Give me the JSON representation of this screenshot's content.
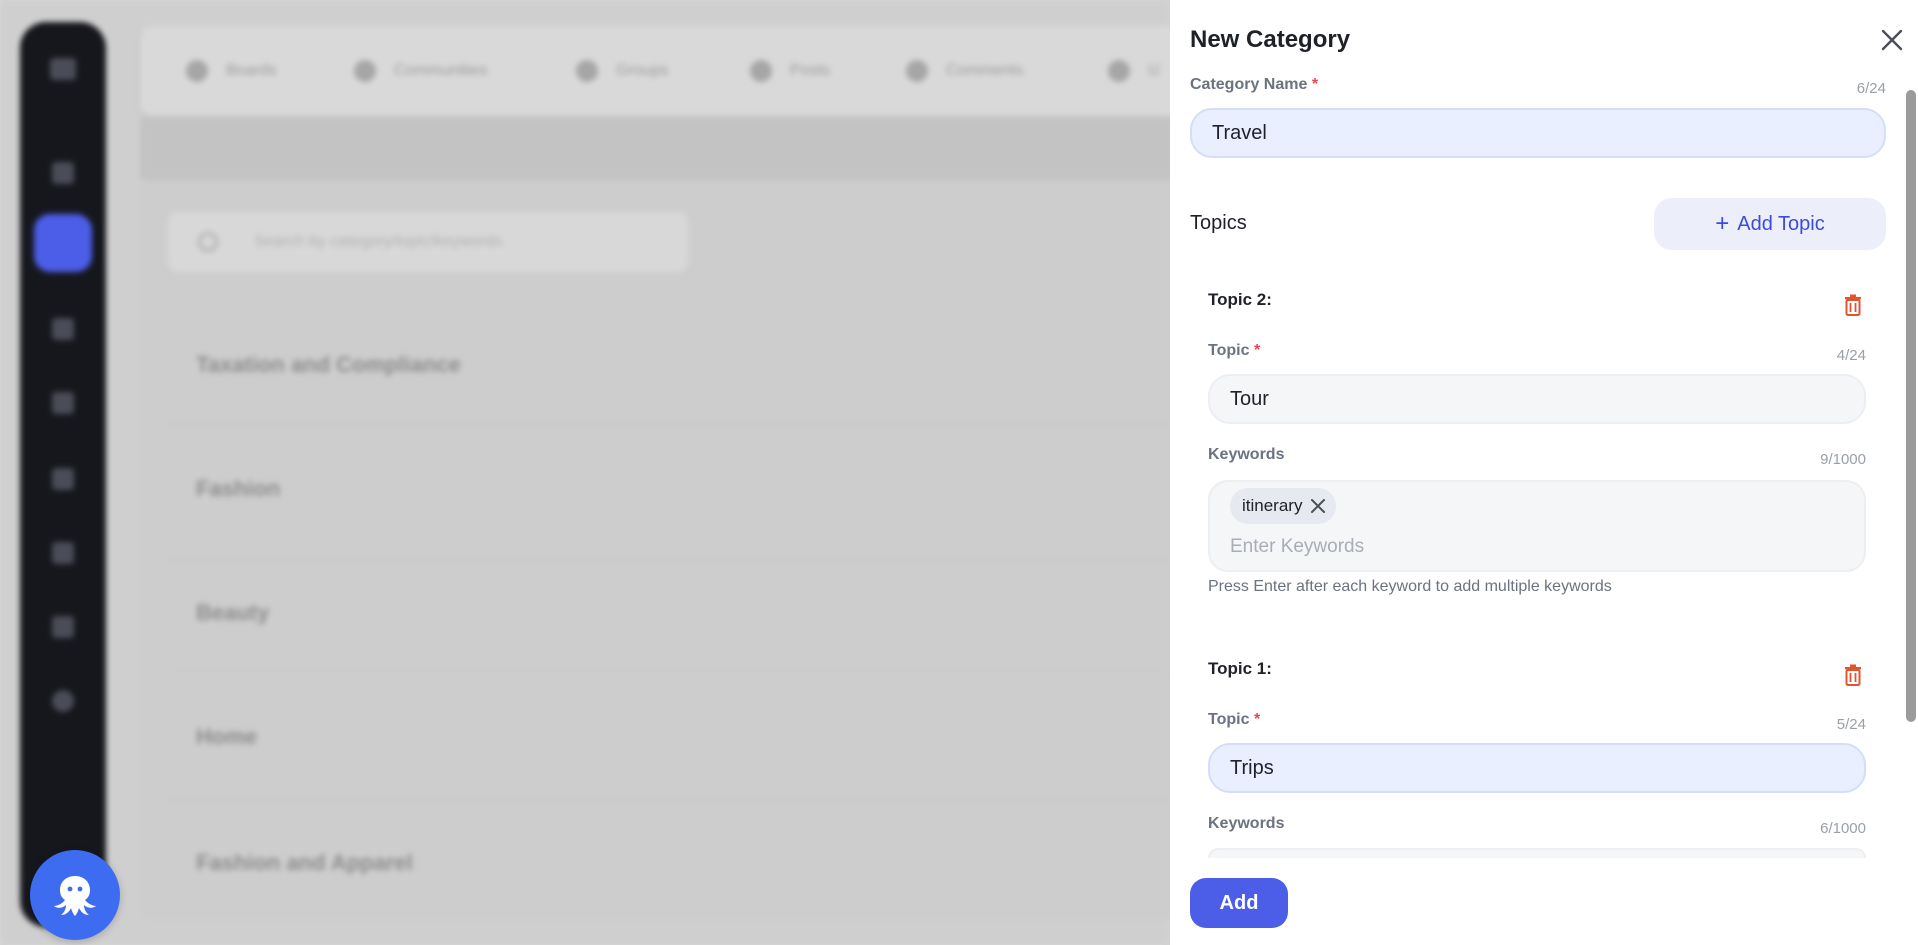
{
  "background": {
    "nav_items": [
      "Boards",
      "Communities",
      "Groups",
      "Posts",
      "Comments",
      "U"
    ],
    "search_placeholder": "Search by category/topic/keywords",
    "rows": [
      "Taxation and Compliance",
      "Fashion",
      "Beauty",
      "Home",
      "Fashion and Apparel"
    ]
  },
  "drawer": {
    "title": "New Category",
    "category_name": {
      "label": "Category Name",
      "required_mark": "*",
      "counter": "6/24",
      "value": "Travel"
    },
    "topics_heading": "Topics",
    "add_topic_label": "Add Topic",
    "add_topic_icon": "+",
    "topics": [
      {
        "title": "Topic 2:",
        "topic_label": "Topic",
        "required_mark": "*",
        "topic_counter": "4/24",
        "topic_value": "Tour",
        "keywords_label": "Keywords",
        "keywords_counter": "9/1000",
        "keywords": [
          "itinerary"
        ],
        "keywords_placeholder": "Enter Keywords",
        "hint": "Press Enter after each keyword to add multiple keywords"
      },
      {
        "title": "Topic 1:",
        "topic_label": "Topic",
        "required_mark": "*",
        "topic_counter": "5/24",
        "topic_value": "Trips",
        "keywords_label": "Keywords",
        "keywords_counter": "6/1000"
      }
    ],
    "submit_label": "Add"
  },
  "colors": {
    "accent": "#4c5ee8",
    "danger": "#e0542f",
    "required": "#e5484d"
  }
}
